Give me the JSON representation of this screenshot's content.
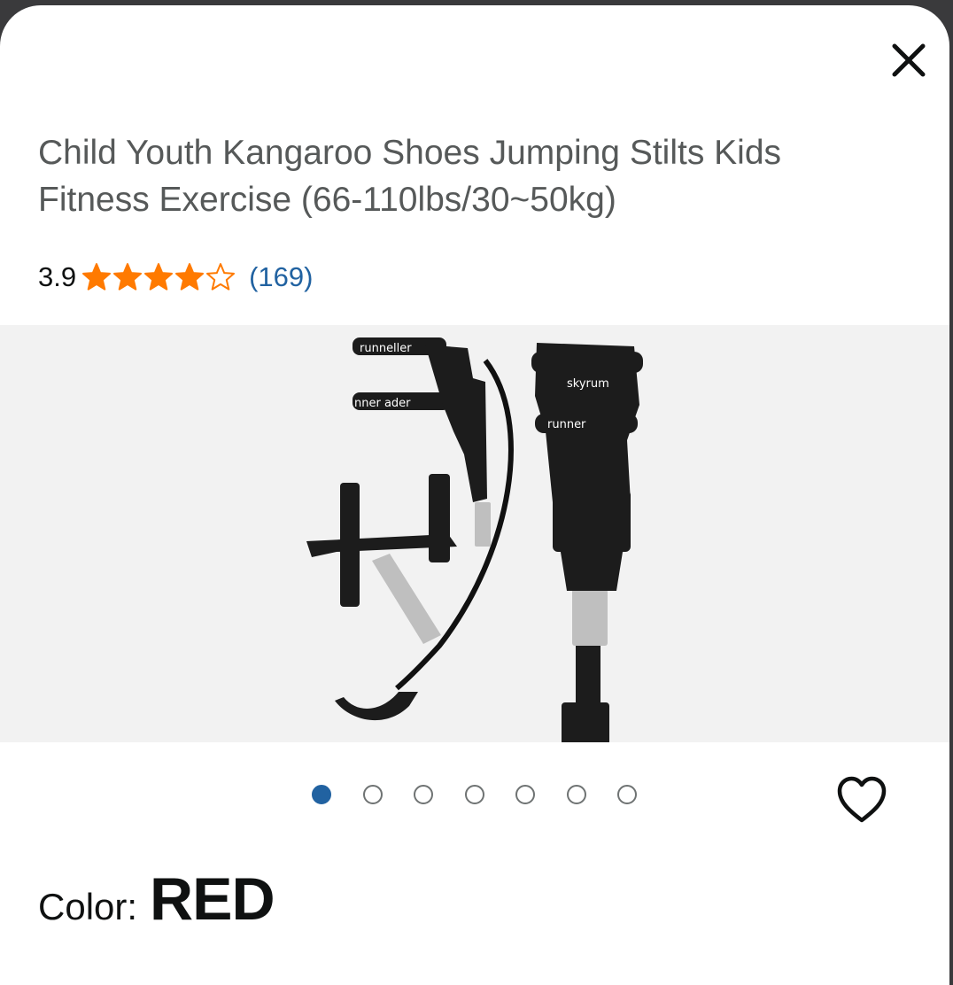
{
  "product": {
    "title": "Child Youth Kangaroo Shoes Jumping Stilts Kids Fitness Exercise (66-110lbs/30~50kg)",
    "rating": {
      "value": "3.9",
      "stars": 3.9,
      "max_stars": 5,
      "count": "(169)"
    },
    "images": {
      "total": 7,
      "active_index": 0
    },
    "color": {
      "label": "Color:",
      "value": "RED"
    }
  },
  "icons": {
    "close": "close-icon",
    "favorite": "heart-icon",
    "star": "star-icon"
  },
  "colors": {
    "star_orange": "#ff7a00",
    "link_blue": "#2162a1",
    "title_gray": "#565959",
    "image_bg": "#f2f2f2"
  }
}
